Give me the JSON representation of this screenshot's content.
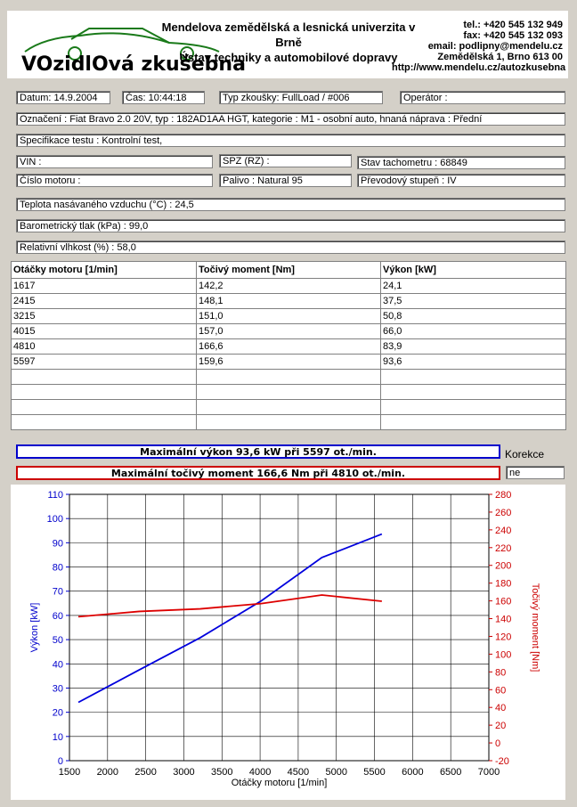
{
  "header": {
    "logo_text_1": "VOzidlOvá",
    "logo_text_2": "zkušebna",
    "university": "Mendelova zemědělská a lesnická univerzita v Brně",
    "institute": "Ústav techniky a automobilové dopravy",
    "tel": "tel.: +420 545 132 949",
    "fax": "fax: +420 545 132 093",
    "email": "email: podlipny@mendelu.cz",
    "address": "Zemědělská 1, Brno 613 00",
    "url": "http://www.mendelu.cz/autozkusebna"
  },
  "info": {
    "date": "Datum: 14.9.2004",
    "time": "Čas: 10:44:18",
    "test_type": "Typ zkoušky: FullLoad / #006",
    "operator": "Operátor :",
    "designation": "Označení : Fiat Bravo 2.0 20V, typ : 182AD1AA       HGT, kategorie : M1 - osobní auto, hnaná náprava : Přední",
    "spec": "Specifikace testu : Kontrolní test,",
    "vin": "VIN :",
    "spz": "SPZ (RZ) :",
    "odometer": "Stav tachometru : 68849",
    "engine_no": "Číslo motoru :",
    "fuel": "Palivo : Natural 95",
    "gear": "Převodový stupeň : IV",
    "intake_temp": "Teplota nasávaného vzduchu (°C) : 24,5",
    "pressure": "Barometrický tlak (kPa) : 99,0",
    "humidity": "Relativní vlhkost (%) : 58,0"
  },
  "table": {
    "headers": [
      "Otáčky motoru [1/min]",
      "Točivý moment [Nm]",
      "Výkon [kW]"
    ],
    "rows": [
      [
        "1617",
        "142,2",
        "24,1"
      ],
      [
        "2415",
        "148,1",
        "37,5"
      ],
      [
        "3215",
        "151,0",
        "50,8"
      ],
      [
        "4015",
        "157,0",
        "66,0"
      ],
      [
        "4810",
        "166,6",
        "83,9"
      ],
      [
        "5597",
        "159,6",
        "93,6"
      ]
    ]
  },
  "summary": {
    "max_power": "Maximální výkon 93,6 kW při 5597 ot./min.",
    "max_torque": "Maximální točivý moment 166,6 Nm při 4810 ot./min.",
    "correction_label": "Korekce",
    "correction_value": "ne",
    "power_color": "#0000cc",
    "torque_color": "#cc0000"
  },
  "chart_data": {
    "type": "line",
    "xlabel": "Otáčky motoru [1/min]",
    "ylabel": "Výkon [kW]",
    "y2label": "Točivý moment [Nm]",
    "xlim": [
      1500,
      7000
    ],
    "ylim": [
      0,
      110
    ],
    "y2lim": [
      -20,
      280
    ],
    "xticks": [
      1500,
      2000,
      2500,
      3000,
      3500,
      4000,
      4500,
      5000,
      5500,
      6000,
      6500,
      7000
    ],
    "yticks": [
      0,
      10,
      20,
      30,
      40,
      50,
      60,
      70,
      80,
      90,
      100,
      110
    ],
    "y2ticks": [
      -20,
      0,
      20,
      40,
      60,
      80,
      100,
      120,
      140,
      160,
      180,
      200,
      220,
      240,
      260,
      280
    ],
    "grid": true,
    "series": [
      {
        "name": "Výkon [kW]",
        "axis": "left",
        "color": "#0000dd",
        "x": [
          1617,
          2415,
          3215,
          4015,
          4810,
          5597
        ],
        "y": [
          24.1,
          37.5,
          50.8,
          66.0,
          83.9,
          93.6
        ]
      },
      {
        "name": "Točivý moment [Nm]",
        "axis": "right",
        "color": "#dd0000",
        "x": [
          1617,
          2415,
          3215,
          4015,
          4810,
          5597
        ],
        "y": [
          142.2,
          148.1,
          151.0,
          157.0,
          166.6,
          159.6
        ]
      }
    ]
  }
}
